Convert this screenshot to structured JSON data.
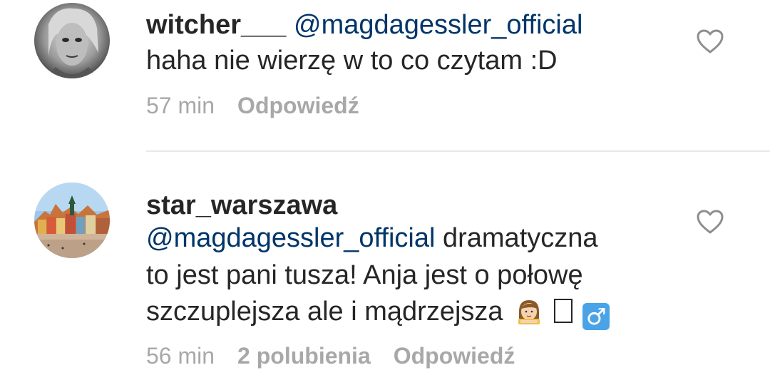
{
  "comments": [
    {
      "username": "witcher___",
      "mention": "@magdagessler_official",
      "text": "haha nie wierzę w to co czytam :D",
      "time": "57 min",
      "reply_label": "Odpowiedź"
    },
    {
      "username": "star_warszawa",
      "mention": "@magdagessler_official",
      "text_line1": "dramatyczna",
      "text_line2": "to jest pani tusza! Anja jest o połowę",
      "text_line3": "szczuplejsza ale i mądrzejsza",
      "emoji_male_sign": "♂",
      "time": "56 min",
      "likes_label": "2 polubienia",
      "reply_label": "Odpowiedź"
    }
  ],
  "icons": {
    "like": "heart-outline-icon"
  },
  "colors": {
    "mention": "#003569",
    "text": "#262626",
    "meta": "#a8a8a8",
    "divider": "#e8e8e8"
  }
}
